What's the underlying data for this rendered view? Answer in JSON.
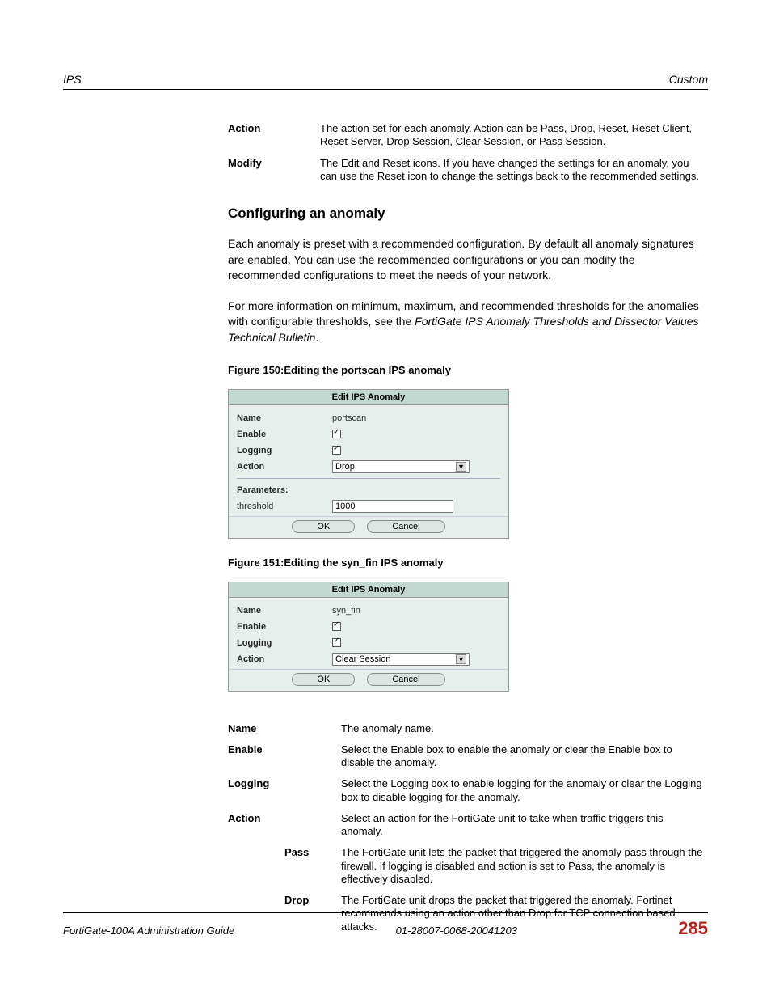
{
  "header": {
    "left": "IPS",
    "right": "Custom"
  },
  "top_defs": [
    {
      "term": "Action",
      "text": "The action set for each anomaly. Action can be Pass, Drop, Reset, Reset Client, Reset Server, Drop Session, Clear Session, or Pass Session."
    },
    {
      "term": "Modify",
      "text": "The Edit and Reset icons. If you have changed the settings for an anomaly, you can use the Reset icon to change the settings back to the recommended settings."
    }
  ],
  "heading": "Configuring an anomaly",
  "para1": "Each anomaly is preset with a recommended configuration. By default all anomaly signatures are enabled. You can use the recommended configurations or you can modify the recommended configurations to meet the needs of your network.",
  "para2a": "For more information on minimum, maximum, and recommended thresholds for the anomalies with configurable thresholds, see the ",
  "para2b": "FortiGate IPS Anomaly Thresholds and Dissector Values Technical Bulletin",
  "para2c": ".",
  "fig150": {
    "caption": "Figure 150:Editing the portscan IPS anomaly",
    "title": "Edit IPS Anomaly",
    "name_label": "Name",
    "name_val": "portscan",
    "enable_label": "Enable",
    "logging_label": "Logging",
    "action_label": "Action",
    "action_val": "Drop",
    "params_label": "Parameters:",
    "threshold_label": "threshold",
    "threshold_val": "1000",
    "ok": "OK",
    "cancel": "Cancel"
  },
  "fig151": {
    "caption": "Figure 151:Editing the syn_fin IPS anomaly",
    "title": "Edit IPS Anomaly",
    "name_label": "Name",
    "name_val": "syn_fin",
    "enable_label": "Enable",
    "logging_label": "Logging",
    "action_label": "Action",
    "action_val": "Clear Session",
    "ok": "OK",
    "cancel": "Cancel"
  },
  "defs2": [
    {
      "term": "Name",
      "text": "The anomaly name."
    },
    {
      "term": "Enable",
      "text": "Select the Enable box to enable the anomaly or clear the Enable box to disable the anomaly."
    },
    {
      "term": "Logging",
      "text": "Select the Logging box to enable logging for the anomaly or clear the Logging box to disable logging for the anomaly."
    },
    {
      "term": "Action",
      "text": "Select an action for the FortiGate unit to take when traffic triggers this anomaly."
    }
  ],
  "subdefs": [
    {
      "term": "Pass",
      "text": "The FortiGate unit lets the packet that triggered the anomaly pass through the firewall. If logging is disabled and action is set to Pass, the anomaly is effectively disabled."
    },
    {
      "term": "Drop",
      "text": "The FortiGate unit drops the packet that triggered the anomaly. Fortinet recommends using an action other than Drop for TCP connection based attacks."
    }
  ],
  "footer": {
    "left": "FortiGate-100A Administration Guide",
    "mid": "01-28007-0068-20041203",
    "page": "285"
  }
}
